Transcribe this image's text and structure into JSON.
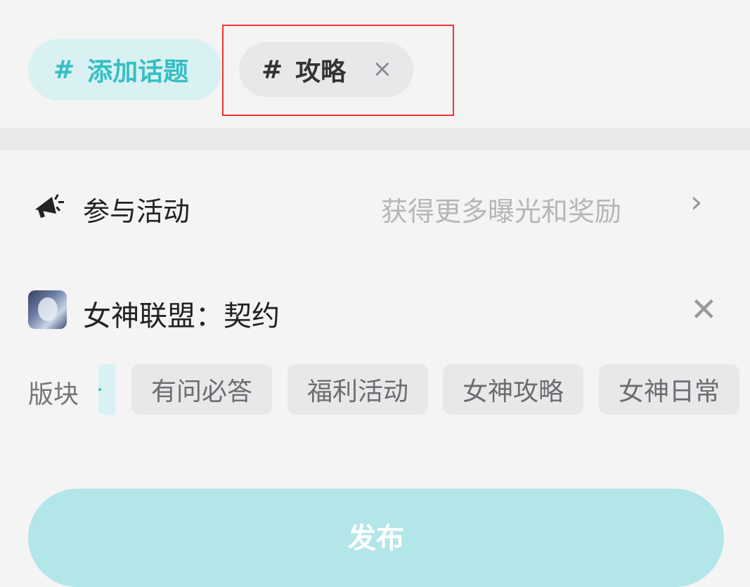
{
  "topics": {
    "add": {
      "hash": "#",
      "label": "添加话题"
    },
    "selected": {
      "hash": "#",
      "label": "攻略",
      "close_icon": "×"
    }
  },
  "activity": {
    "icon": "megaphone-icon",
    "title": "参与活动",
    "hint": "获得更多曝光和奖励",
    "chevron": "›"
  },
  "game": {
    "title": "女神联盟：契约",
    "close_icon": "✕"
  },
  "board": {
    "label": "版块",
    "chips": [
      "有问必答",
      "福利活动",
      "女神攻略",
      "女神日常"
    ]
  },
  "publish_label": "发布",
  "colors": {
    "accent": "#35bfc4",
    "accent_light": "#d9f1f2",
    "publish_bg": "#b3e6e8",
    "highlight": "#ee3333"
  }
}
